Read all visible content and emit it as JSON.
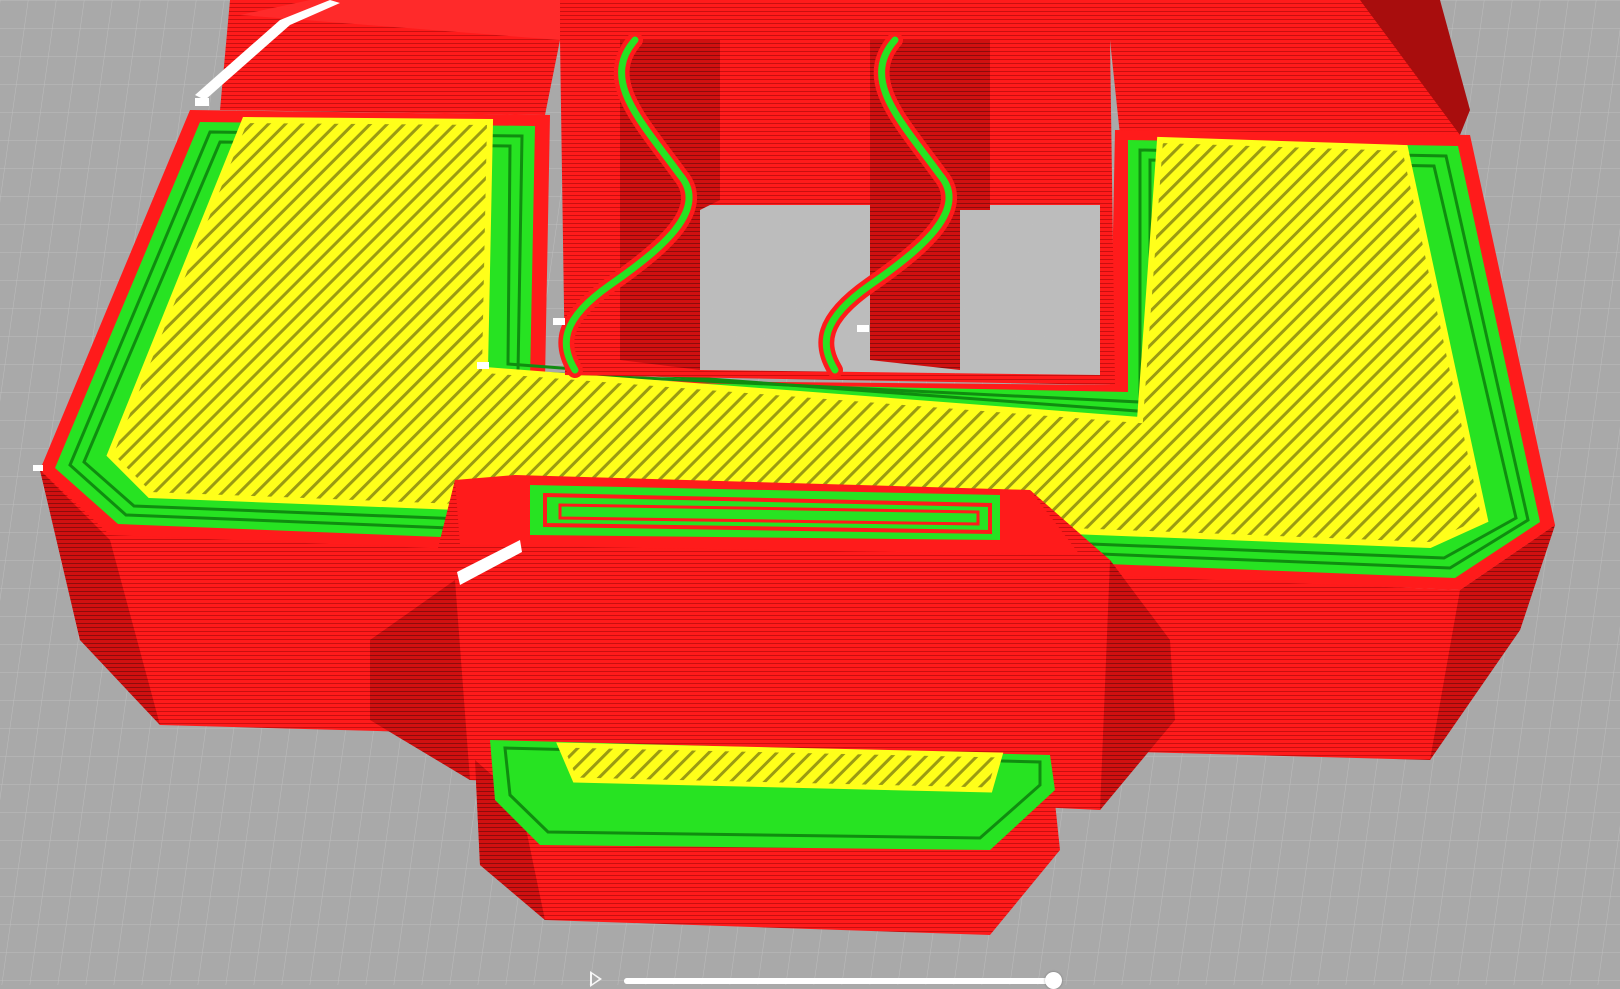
{
  "viewport": {
    "background_color": "#a9a9a9",
    "grid_color": "#bdbdbd",
    "colors": {
      "wall_outer": "#ff1b1b",
      "wall_shade": "#d20f0f",
      "wall_dark": "#8c0c0c",
      "wall_inner": "#27e322",
      "infill": "#ffff1a",
      "travel": "#ffffff"
    }
  },
  "layer_slider": {
    "progress": 1.0,
    "play_icon": "play-icon"
  }
}
